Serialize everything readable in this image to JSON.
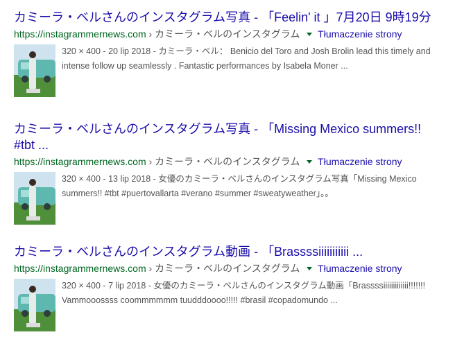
{
  "results": [
    {
      "title": "カミーラ・ベルさんのインスタグラム写真 - 「Feelin' it 」7月20日 9時19分",
      "url": "https://instagrammernews.com",
      "crumb": "カミーラ・ベルのインスタグラム",
      "separator": "›",
      "translate": "Tłumaczenie strony",
      "meta": "320 × 400 - 20 lip 2018 - ",
      "snippet": "カミーラ・ベル： Benicio del Toro and Josh Brolin lead this timely and intense follow up seamlessly . Fantastic performances by Isabela Moner ..."
    },
    {
      "title": "カミーラ・ベルさんのインスタグラム写真 - 「Missing Mexico summers!! #tbt ...",
      "url": "https://instagrammernews.com",
      "crumb": "カミーラ・ベルのインスタグラム",
      "separator": "›",
      "translate": "Tłumaczenie strony",
      "meta": "320 × 400 - 13 lip 2018 - ",
      "snippet": "女優のカミーラ・ベルさんのインスタグラム写真「Missing Mexico summers!! #tbt #puertovallarta #verano #summer #sweatyweather」。。"
    },
    {
      "title": "カミーラ・ベルさんのインスタグラム動画 - 「Brassssiiiiiiiiiii ...",
      "url": "https://instagrammernews.com",
      "crumb": "カミーラ・ベルのインスタグラム",
      "separator": "›",
      "translate": "Tłumaczenie strony",
      "meta": "320 × 400 - 7 lip 2018 - ",
      "snippet": "女優のカミーラ・ベルさんのインスタグラム動画「Brassssiiiiiiiiiiiii!!!!!!! Vammooossss coommmmmm tuudddoooo!!!!! #brasil #copadomundo ..."
    }
  ],
  "colors": {
    "title": "#1a0dab",
    "url": "#006621",
    "snippet": "#545454",
    "thumb_car": "#5fb8b0",
    "thumb_grass": "#4f8f3a"
  }
}
